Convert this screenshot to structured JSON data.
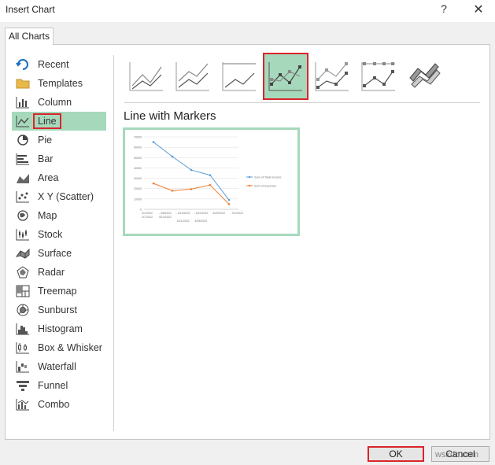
{
  "window": {
    "title": "Insert Chart",
    "help_glyph": "?",
    "close_glyph": "✕"
  },
  "tabs": [
    {
      "label": "All Charts"
    }
  ],
  "sidebar": {
    "items": [
      {
        "label": "Recent",
        "icon": "recent-icon"
      },
      {
        "label": "Templates",
        "icon": "folder-icon"
      },
      {
        "label": "Column",
        "icon": "column-chart-icon"
      },
      {
        "label": "Line",
        "icon": "line-chart-icon",
        "selected": true
      },
      {
        "label": "Pie",
        "icon": "pie-chart-icon"
      },
      {
        "label": "Bar",
        "icon": "bar-chart-icon"
      },
      {
        "label": "Area",
        "icon": "area-chart-icon"
      },
      {
        "label": "X Y (Scatter)",
        "icon": "scatter-chart-icon"
      },
      {
        "label": "Map",
        "icon": "map-chart-icon"
      },
      {
        "label": "Stock",
        "icon": "stock-chart-icon"
      },
      {
        "label": "Surface",
        "icon": "surface-chart-icon"
      },
      {
        "label": "Radar",
        "icon": "radar-chart-icon"
      },
      {
        "label": "Treemap",
        "icon": "treemap-chart-icon"
      },
      {
        "label": "Sunburst",
        "icon": "sunburst-chart-icon"
      },
      {
        "label": "Histogram",
        "icon": "histogram-chart-icon"
      },
      {
        "label": "Box & Whisker",
        "icon": "box-whisker-chart-icon"
      },
      {
        "label": "Waterfall",
        "icon": "waterfall-chart-icon"
      },
      {
        "label": "Funnel",
        "icon": "funnel-chart-icon"
      },
      {
        "label": "Combo",
        "icon": "combo-chart-icon"
      }
    ]
  },
  "subtypes": {
    "selected_index": 3,
    "items": [
      "line",
      "stacked-line",
      "100-stacked-line",
      "line-with-markers",
      "stacked-line-with-markers",
      "100-stacked-line-with-markers",
      "3d-line"
    ]
  },
  "chart_heading": "Line with Markers",
  "preview": {
    "chart_data": {
      "type": "line",
      "categories": [
        "4/1/2022 - 4/7/2022",
        "4/8/2022 - 4/14/2022",
        "4/15/2022 - 4/21/2022",
        "4/22/2022 - 4/28/2022",
        "4/29/2022 - 4/30/2022",
        "5/1/2022"
      ],
      "tick_lines": [
        [
          "4/1/2022",
          "- 4/8/2022",
          "- 4/15/2022",
          "- 4/22/2022",
          "4/29/2022",
          "- 5/1/2022"
        ],
        [
          "4/7/2022",
          "4/14/2022",
          "",
          "",
          "",
          ""
        ],
        [
          "",
          "",
          "4/21/2022",
          "4/28/2022",
          "",
          ""
        ]
      ],
      "series": [
        {
          "name": "Sum of Total Income",
          "values": [
            65000,
            51000,
            38000,
            33000,
            9000
          ],
          "color": "#5b9bd5"
        },
        {
          "name": "Sum of Expense",
          "values": [
            25000,
            18000,
            19500,
            23500,
            5000
          ],
          "color": "#ed7d31"
        }
      ],
      "ylim": [
        0,
        70000
      ],
      "yticks": [
        "0",
        "10000",
        "20000",
        "30000",
        "40000",
        "50000",
        "60000",
        "70000"
      ],
      "grid": true,
      "legend_position": "right"
    }
  },
  "buttons": {
    "ok": "OK",
    "cancel": "Cancel"
  },
  "watermark": "wsxdn.com",
  "colors": {
    "selected_bg": "#a6d9bc",
    "highlight_border": "#d9252b"
  }
}
